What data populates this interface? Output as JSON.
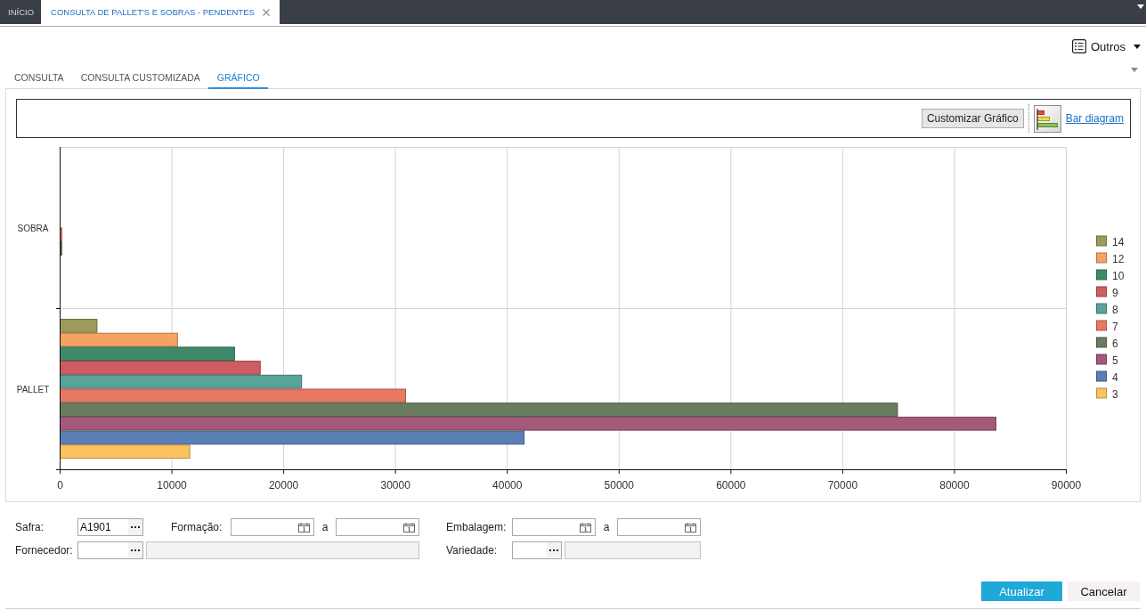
{
  "top_tabs": [
    {
      "label": "INÍCIO",
      "selected": false,
      "closable": false
    },
    {
      "label": "CONSULTA DE PALLET'S E SOBRAS - PENDENTES",
      "selected": true,
      "closable": true
    }
  ],
  "header": {
    "menu_button": "Outros"
  },
  "view_tabs": [
    {
      "label": "CONSULTA",
      "selected": false
    },
    {
      "label": "CONSULTA CUSTOMIZADA",
      "selected": false
    },
    {
      "label": "GRÁFICO",
      "selected": true
    }
  ],
  "chart_panel": {
    "customize_button": "Customizar Gráfico",
    "chart_type_link": "Bar diagram",
    "chart_data": {
      "type": "bar",
      "orientation": "horizontal",
      "grid": true,
      "legend": "right",
      "categories": [
        "SOBRA",
        "PALLET"
      ],
      "series": [
        {
          "name": "14",
          "color": "#9c9a5c",
          "values": [
            0,
            3300
          ]
        },
        {
          "name": "12",
          "color": "#f6a263",
          "values": [
            0,
            10500
          ]
        },
        {
          "name": "10",
          "color": "#3f8a6a",
          "values": [
            0,
            15600
          ]
        },
        {
          "name": "9",
          "color": "#cd5c63",
          "values": [
            0,
            17900
          ]
        },
        {
          "name": "8",
          "color": "#58a39a",
          "values": [
            0,
            21600
          ]
        },
        {
          "name": "7",
          "color": "#e87862",
          "values": [
            150,
            30900
          ]
        },
        {
          "name": "6",
          "color": "#6a7c60",
          "values": [
            150,
            74900
          ]
        },
        {
          "name": "5",
          "color": "#a35a7a",
          "values": [
            0,
            83700
          ]
        },
        {
          "name": "4",
          "color": "#5a7fb5",
          "values": [
            0,
            41500
          ]
        },
        {
          "name": "3",
          "color": "#fdc260",
          "values": [
            0,
            11600
          ]
        }
      ],
      "xlim": [
        0,
        90000
      ],
      "xticks": [
        0,
        10000,
        20000,
        30000,
        40000,
        50000,
        60000,
        70000,
        80000,
        90000
      ]
    }
  },
  "filter_rows": [
    [
      {
        "kind": "lookup",
        "label": "Safra:",
        "value": "A1901"
      },
      {
        "kind": "date_range",
        "label": "Formação:",
        "separator": "a"
      },
      {
        "kind": "date_range",
        "label": "Embalagem:",
        "separator": "a"
      }
    ],
    [
      {
        "kind": "lookup_with_description",
        "label": "Fornecedor:"
      },
      {
        "kind": "lookup_with_description",
        "label": "Variedade:"
      }
    ]
  ],
  "buttons": [
    {
      "label": "Atualizar",
      "kind": "primary"
    },
    {
      "label": "Cancelar",
      "kind": "secondary"
    }
  ]
}
